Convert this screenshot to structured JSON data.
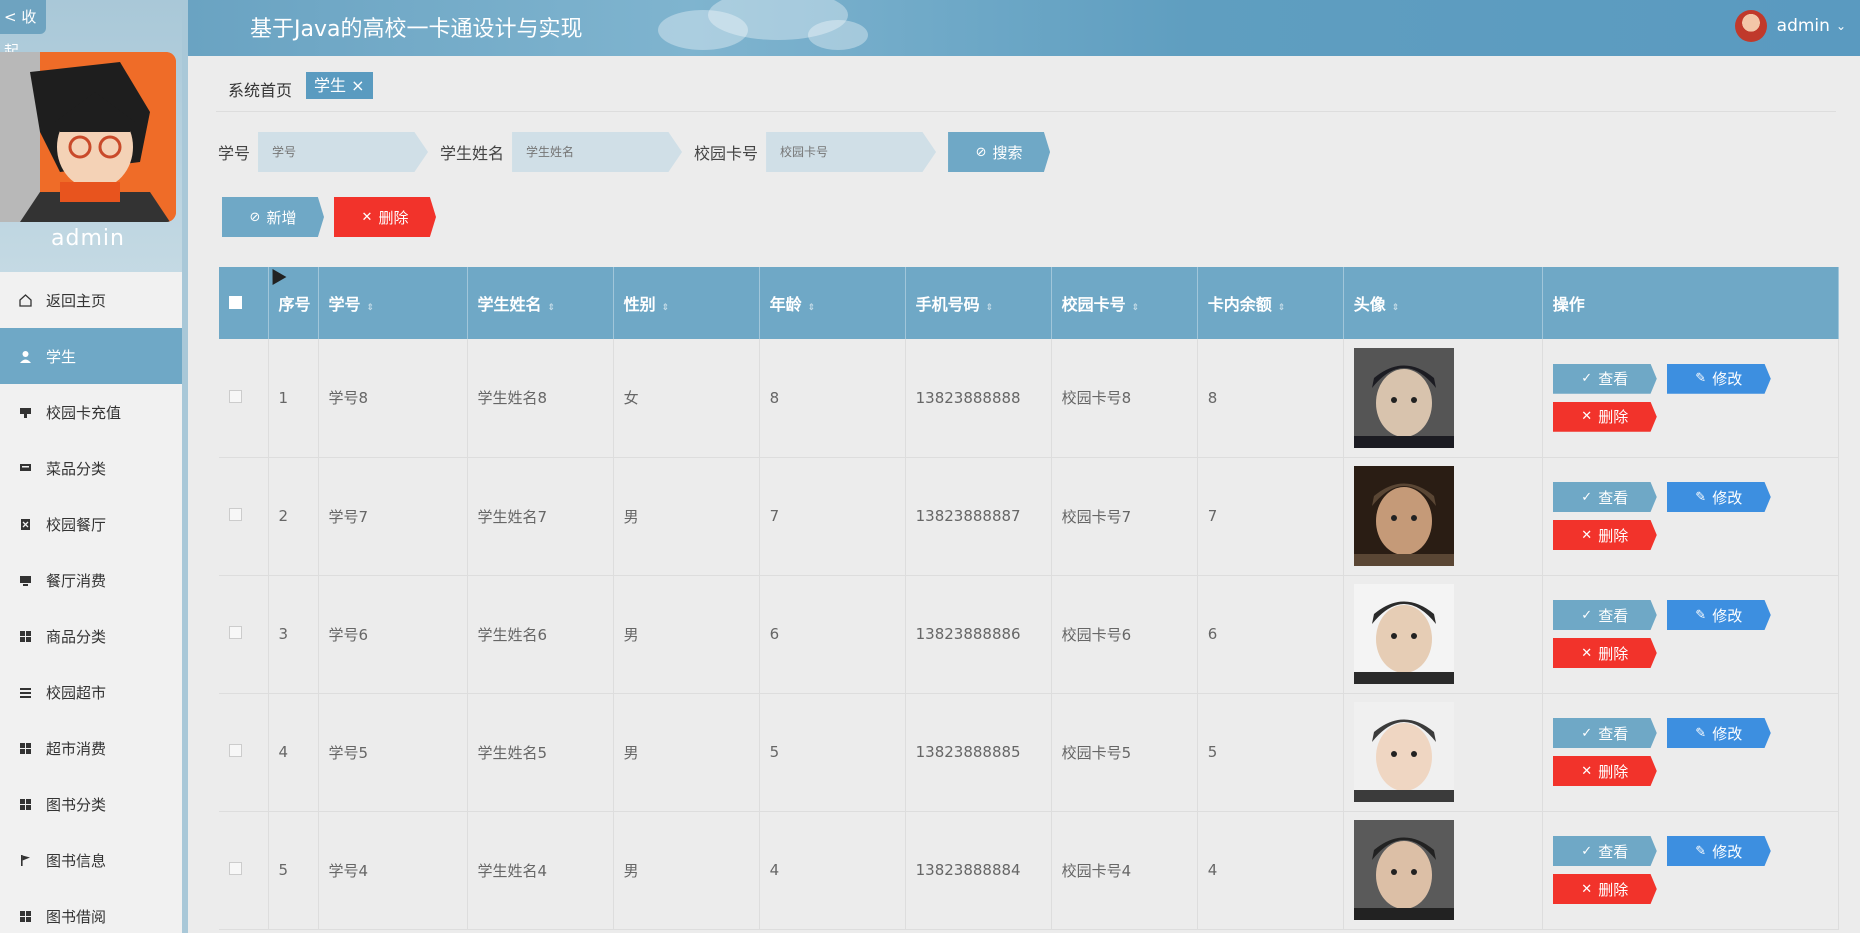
{
  "sidebar": {
    "collapse_label": "< 收起",
    "username": "admin",
    "items": [
      {
        "label": "返回主页",
        "icon": "home-icon"
      },
      {
        "label": "学生",
        "icon": "user-icon",
        "active": true
      },
      {
        "label": "校园卡充值",
        "icon": "card-icon"
      },
      {
        "label": "菜品分类",
        "icon": "dish-icon"
      },
      {
        "label": "校园餐厅",
        "icon": "restaurant-icon"
      },
      {
        "label": "餐厅消费",
        "icon": "monitor-icon"
      },
      {
        "label": "商品分类",
        "icon": "grid-icon"
      },
      {
        "label": "校园超市",
        "icon": "list-icon"
      },
      {
        "label": "超市消费",
        "icon": "grid-icon"
      },
      {
        "label": "图书分类",
        "icon": "grid-icon"
      },
      {
        "label": "图书信息",
        "icon": "flag-icon"
      },
      {
        "label": "图书借阅",
        "icon": "grid-icon"
      }
    ]
  },
  "header": {
    "title": "基于Java的高校一卡通设计与实现",
    "user": "admin"
  },
  "breadcrumb": {
    "home": "系统首页",
    "tag": "学生"
  },
  "search": {
    "student_no_label": "学号",
    "student_no_placeholder": "学号",
    "name_label": "学生姓名",
    "name_placeholder": "学生姓名",
    "card_label": "校园卡号",
    "card_placeholder": "校园卡号",
    "search_button": "搜索"
  },
  "actions": {
    "add": "新增",
    "delete": "删除"
  },
  "table": {
    "columns": [
      "序号",
      "学号",
      "学生姓名",
      "性别",
      "年龄",
      "手机号码",
      "校园卡号",
      "卡内余额",
      "头像",
      "操作"
    ],
    "rows": [
      {
        "idx": "1",
        "no": "学号8",
        "name": "学生姓名8",
        "gender": "女",
        "age": "8",
        "phone": "13823888888",
        "card": "校园卡号8",
        "balance": "8"
      },
      {
        "idx": "2",
        "no": "学号7",
        "name": "学生姓名7",
        "gender": "男",
        "age": "7",
        "phone": "13823888887",
        "card": "校园卡号7",
        "balance": "7"
      },
      {
        "idx": "3",
        "no": "学号6",
        "name": "学生姓名6",
        "gender": "男",
        "age": "6",
        "phone": "13823888886",
        "card": "校园卡号6",
        "balance": "6"
      },
      {
        "idx": "4",
        "no": "学号5",
        "name": "学生姓名5",
        "gender": "男",
        "age": "5",
        "phone": "13823888885",
        "card": "校园卡号5",
        "balance": "5"
      },
      {
        "idx": "5",
        "no": "学号4",
        "name": "学生姓名4",
        "gender": "男",
        "age": "4",
        "phone": "13823888884",
        "card": "校园卡号4",
        "balance": "4"
      }
    ],
    "row_ops": {
      "view": "查看",
      "edit": "修改",
      "delete": "删除"
    }
  },
  "colors": {
    "primary": "#6fa8c6",
    "edit": "#3d8fe0",
    "danger": "#f2332b"
  }
}
